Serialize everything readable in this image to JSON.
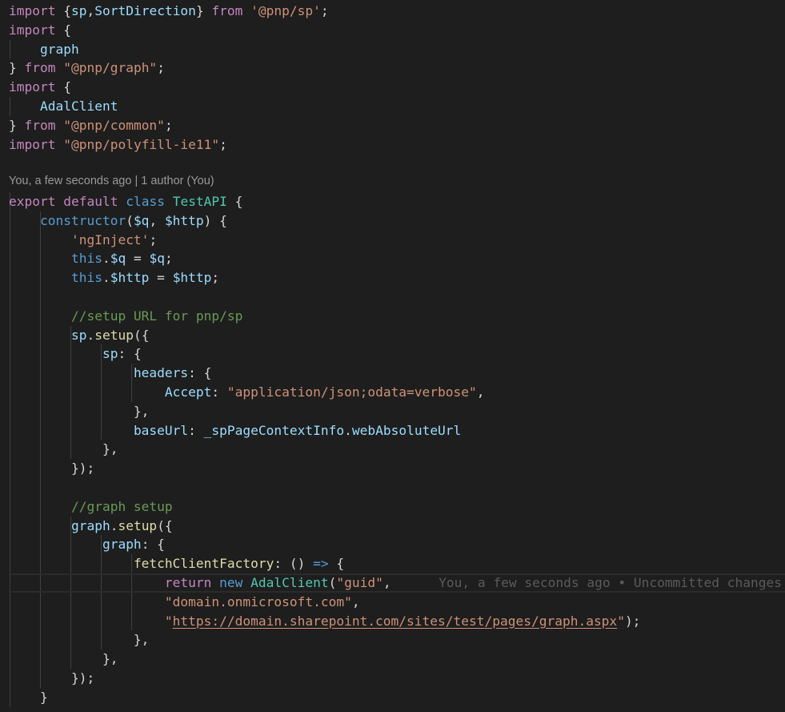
{
  "codelens": {
    "text": "You, a few seconds ago | 1 author (You)"
  },
  "blame": {
    "text": "You, a few seconds ago • Uncommitted changes"
  },
  "theme": {
    "background": "#1e1e1e",
    "keyword": "#c586c0",
    "storage": "#569cd6",
    "string": "#ce9178",
    "function": "#dcdcaa",
    "class": "#4ec9b0",
    "variable": "#9cdcfe",
    "comment": "#6a9955"
  },
  "code": {
    "lines": [
      [
        [
          "kw",
          "import"
        ],
        [
          "pn",
          " {"
        ],
        [
          "vr",
          "sp"
        ],
        [
          "pn",
          ","
        ],
        [
          "vr",
          "SortDirection"
        ],
        [
          "pn",
          "} "
        ],
        [
          "kw",
          "from"
        ],
        [
          "pn",
          " "
        ],
        [
          "str",
          "'@pnp/sp'"
        ],
        [
          "pn",
          ";"
        ]
      ],
      [
        [
          "kw",
          "import"
        ],
        [
          "pn",
          " {"
        ]
      ],
      [
        [
          "pn",
          "    "
        ],
        [
          "vr",
          "graph"
        ]
      ],
      [
        [
          "pn",
          "} "
        ],
        [
          "kw",
          "from"
        ],
        [
          "pn",
          " "
        ],
        [
          "str",
          "\"@pnp/graph\""
        ],
        [
          "pn",
          ";"
        ]
      ],
      [
        [
          "kw",
          "import"
        ],
        [
          "pn",
          " {"
        ]
      ],
      [
        [
          "pn",
          "    "
        ],
        [
          "vr",
          "AdalClient"
        ]
      ],
      [
        [
          "pn",
          "} "
        ],
        [
          "kw",
          "from"
        ],
        [
          "pn",
          " "
        ],
        [
          "str",
          "\"@pnp/common\""
        ],
        [
          "pn",
          ";"
        ]
      ],
      [
        [
          "kw",
          "import"
        ],
        [
          "pn",
          " "
        ],
        [
          "str",
          "\"@pnp/polyfill-ie11\""
        ],
        [
          "pn",
          ";"
        ]
      ],
      [],
      [
        [
          "kw",
          "export"
        ],
        [
          "pn",
          " "
        ],
        [
          "kw",
          "default"
        ],
        [
          "pn",
          " "
        ],
        [
          "sk",
          "class"
        ],
        [
          "pn",
          " "
        ],
        [
          "cls",
          "TestAPI"
        ],
        [
          "pn",
          " {"
        ]
      ],
      [
        [
          "pn",
          "    "
        ],
        [
          "sk",
          "constructor"
        ],
        [
          "pn",
          "("
        ],
        [
          "vr",
          "$q"
        ],
        [
          "pn",
          ", "
        ],
        [
          "vr",
          "$http"
        ],
        [
          "pn",
          ") {"
        ]
      ],
      [
        [
          "pn",
          "        "
        ],
        [
          "str",
          "'ngInject'"
        ],
        [
          "pn",
          ";"
        ]
      ],
      [
        [
          "pn",
          "        "
        ],
        [
          "sk",
          "this"
        ],
        [
          "pn",
          "."
        ],
        [
          "vr",
          "$q"
        ],
        [
          "pn",
          " = "
        ],
        [
          "vr",
          "$q"
        ],
        [
          "pn",
          ";"
        ]
      ],
      [
        [
          "pn",
          "        "
        ],
        [
          "sk",
          "this"
        ],
        [
          "pn",
          "."
        ],
        [
          "vr",
          "$http"
        ],
        [
          "pn",
          " = "
        ],
        [
          "vr",
          "$http"
        ],
        [
          "pn",
          ";"
        ]
      ],
      [],
      [
        [
          "pn",
          "        "
        ],
        [
          "cm",
          "//setup URL for pnp/sp"
        ]
      ],
      [
        [
          "pn",
          "        "
        ],
        [
          "vr",
          "sp"
        ],
        [
          "pn",
          "."
        ],
        [
          "fn",
          "setup"
        ],
        [
          "pn",
          "({"
        ]
      ],
      [
        [
          "pn",
          "            "
        ],
        [
          "vr",
          "sp"
        ],
        [
          "pn",
          ": {"
        ]
      ],
      [
        [
          "pn",
          "                "
        ],
        [
          "vr",
          "headers"
        ],
        [
          "pn",
          ": {"
        ]
      ],
      [
        [
          "pn",
          "                    "
        ],
        [
          "vr",
          "Accept"
        ],
        [
          "pn",
          ": "
        ],
        [
          "str",
          "\"application/json;odata=verbose\""
        ],
        [
          "pn",
          ","
        ]
      ],
      [
        [
          "pn",
          "                },"
        ]
      ],
      [
        [
          "pn",
          "                "
        ],
        [
          "vr",
          "baseUrl"
        ],
        [
          "pn",
          ": "
        ],
        [
          "vr",
          "_spPageContextInfo"
        ],
        [
          "pn",
          "."
        ],
        [
          "vr",
          "webAbsoluteUrl"
        ]
      ],
      [
        [
          "pn",
          "            },"
        ]
      ],
      [
        [
          "pn",
          "        });"
        ]
      ],
      [],
      [
        [
          "pn",
          "        "
        ],
        [
          "cm",
          "//graph setup"
        ]
      ],
      [
        [
          "pn",
          "        "
        ],
        [
          "vr",
          "graph"
        ],
        [
          "pn",
          "."
        ],
        [
          "fn",
          "setup"
        ],
        [
          "pn",
          "({"
        ]
      ],
      [
        [
          "pn",
          "            "
        ],
        [
          "vr",
          "graph"
        ],
        [
          "pn",
          ": {"
        ]
      ],
      [
        [
          "pn",
          "                "
        ],
        [
          "fn",
          "fetchClientFactory"
        ],
        [
          "pn",
          ": () "
        ],
        [
          "sk",
          "=>"
        ],
        [
          "pn",
          " {"
        ]
      ],
      [
        [
          "pn",
          "                    "
        ],
        [
          "kw",
          "return"
        ],
        [
          "pn",
          " "
        ],
        [
          "sk",
          "new"
        ],
        [
          "pn",
          " "
        ],
        [
          "cls",
          "AdalClient"
        ],
        [
          "pn",
          "("
        ],
        [
          "str",
          "\"guid\""
        ],
        [
          "pn",
          ","
        ]
      ],
      [
        [
          "pn",
          "                    "
        ],
        [
          "str",
          "\"domain.onmicrosoft.com\""
        ],
        [
          "pn",
          ","
        ]
      ],
      [
        [
          "pn",
          "                    "
        ],
        [
          "str",
          "\""
        ],
        [
          "str ul",
          "https://domain.sharepoint.com/sites/test/pages/graph.aspx"
        ],
        [
          "str",
          "\""
        ],
        [
          "pn",
          ");"
        ]
      ],
      [
        [
          "pn",
          "                },"
        ]
      ],
      [
        [
          "pn",
          "            },"
        ]
      ],
      [
        [
          "pn",
          "        });"
        ]
      ],
      [
        [
          "pn",
          "    }"
        ]
      ]
    ]
  }
}
